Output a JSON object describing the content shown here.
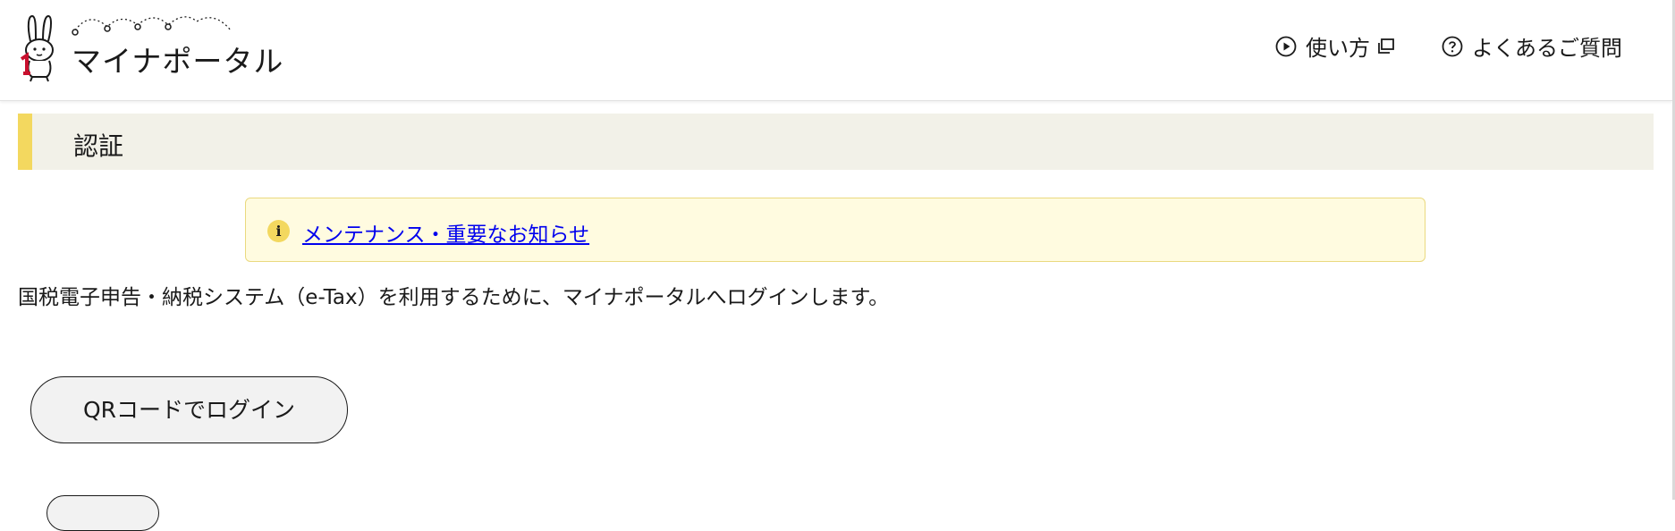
{
  "header": {
    "logo_text": "マイナポータル",
    "nav": [
      {
        "label": "使い方",
        "icon": "play-circle-icon",
        "ext_icon": "external-window-icon"
      },
      {
        "label": "よくあるご質問",
        "icon": "question-circle-icon"
      }
    ]
  },
  "section": {
    "title": "認証"
  },
  "notice": {
    "icon": "info-icon",
    "icon_glyph": "i",
    "link": "メンテナンス・重要なお知らせ"
  },
  "description": "国税電子申告・納税システム（e-Tax）を利用するために、マイナポータルへログインします。",
  "buttons": {
    "qr_login": "QRコードでログイン"
  },
  "colors": {
    "accent_yellow": "#f3d85f",
    "section_bg": "#f2f1e8",
    "notice_bg": "#fffbe0",
    "link": "#0000ee"
  }
}
